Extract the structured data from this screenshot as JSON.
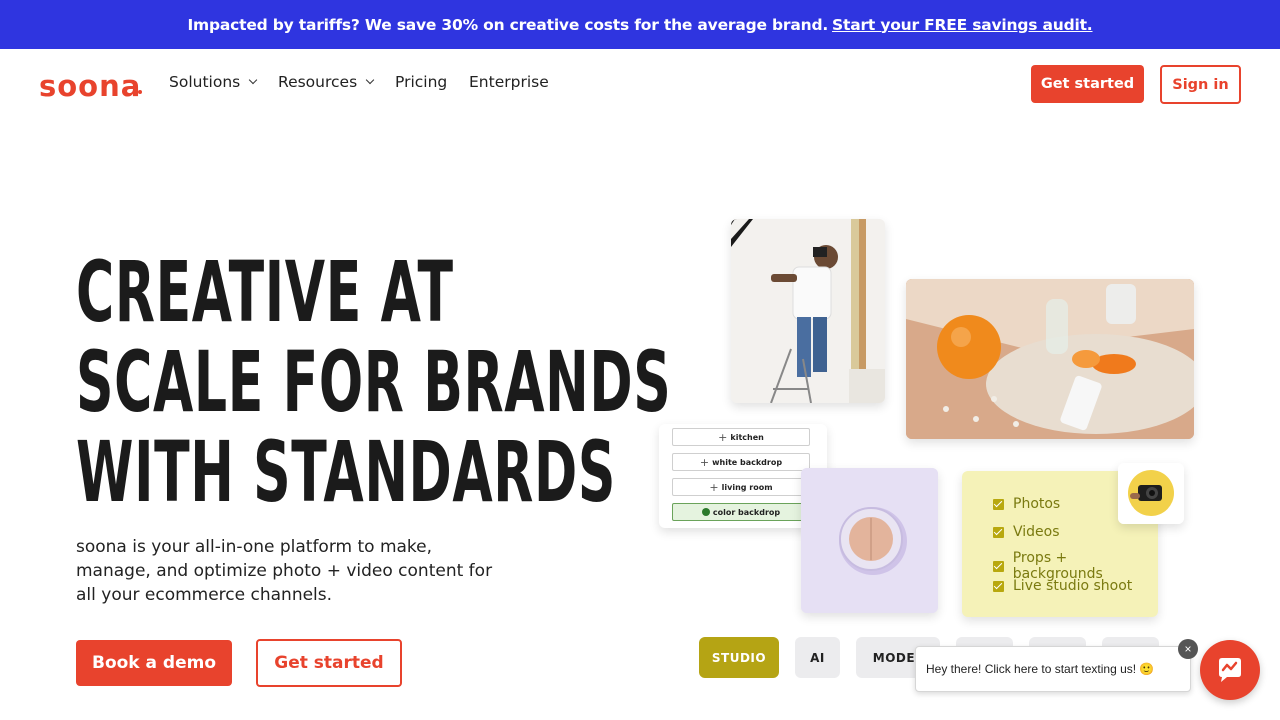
{
  "banner": {
    "text": "Impacted by tariffs? We save 30% on creative costs for the average brand.",
    "link": "Start your FREE savings audit."
  },
  "nav": {
    "logo": "soona",
    "items": [
      {
        "label": "Solutions"
      },
      {
        "label": "Resources"
      },
      {
        "label": "Pricing"
      },
      {
        "label": "Enterprise"
      }
    ],
    "get_started": "Get started",
    "sign_in": "Sign in"
  },
  "hero": {
    "title_lines": [
      "CREATIVE AT",
      "SCALE FOR BRANDS",
      "WITH STANDARDS"
    ],
    "subtitle": "soona is your all-in-one platform to make, manage, and optimize photo + video content for all your ecommerce channels.",
    "book_demo": "Book a demo",
    "get_started": "Get started"
  },
  "collage": {
    "tags": [
      "kitchen",
      "white backdrop",
      "living room",
      "color backdrop"
    ],
    "checklist": [
      "Photos",
      "Videos",
      "Props + backgrounds",
      "Live studio shoot"
    ],
    "pills": [
      "STUDIO",
      "AI",
      "MODEL",
      "",
      "",
      ""
    ]
  },
  "chat": {
    "bubble": "Hey there! Click here to start texting us! 🙂",
    "close": "×"
  },
  "colors": {
    "banner": "#2f35e0",
    "brand": "#e8432d",
    "studio_pill": "#b5a414",
    "checklist_bg": "#f5f2b8"
  }
}
